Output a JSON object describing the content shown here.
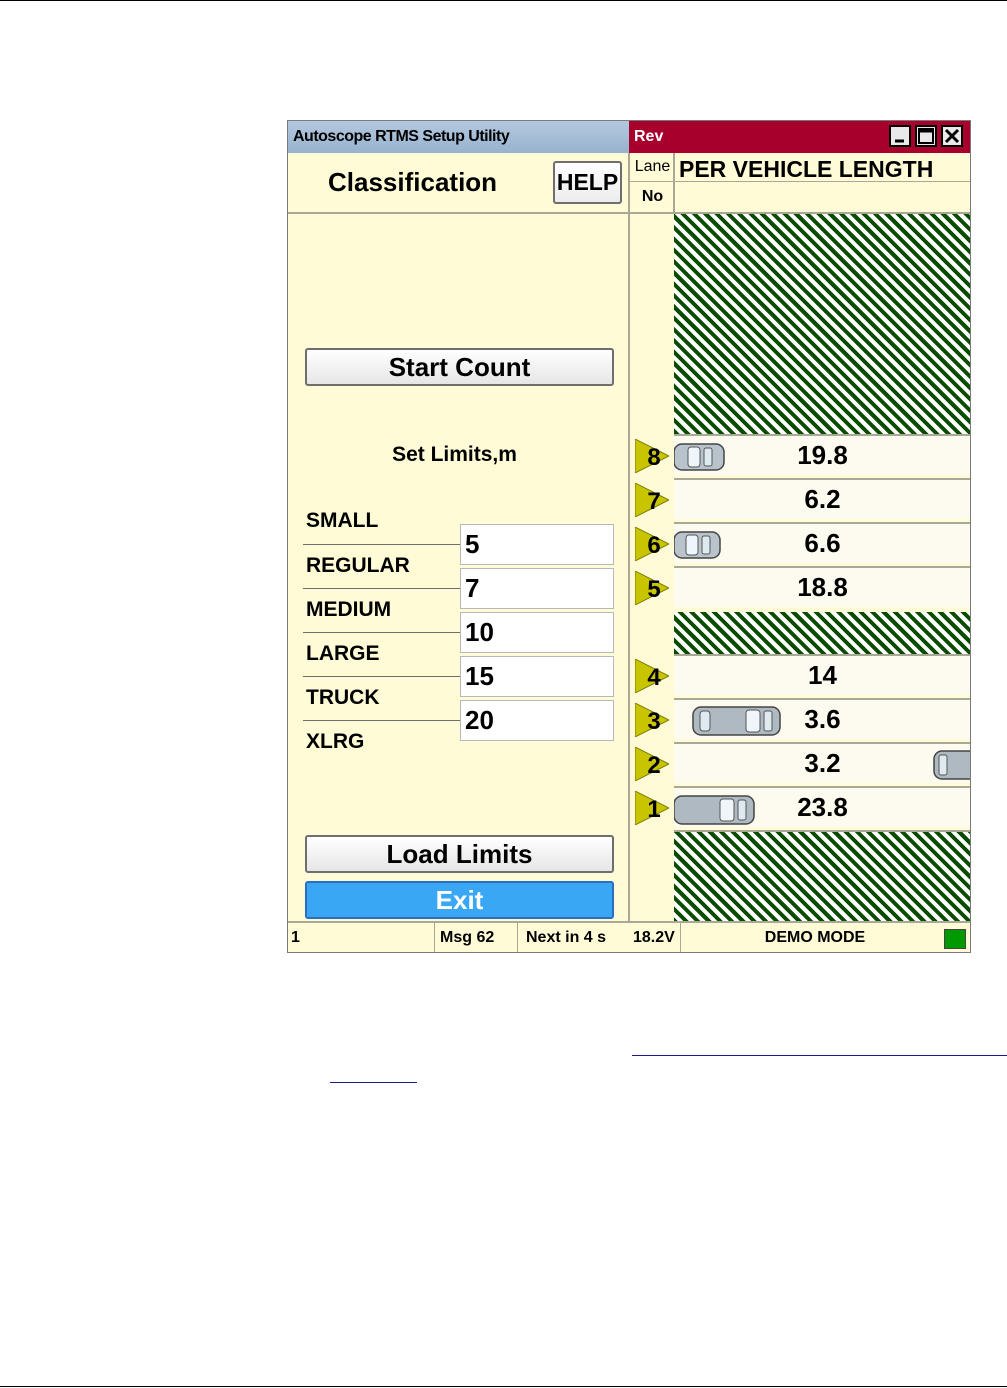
{
  "window": {
    "title": "Autoscope RTMS Setup Utility",
    "mode_label": "Rev",
    "icons": {
      "minimize": "minimize-icon",
      "maximize": "maximize-icon",
      "close": "close-icon"
    }
  },
  "header": {
    "section_title": "Classification",
    "help_label": "HELP",
    "lane_label": "Lane",
    "no_label": "No",
    "chart_title": "PER VEHICLE LENGTH"
  },
  "controls": {
    "start_count_label": "Start Count",
    "set_limits_label": "Set Limits,m",
    "load_limits_label": "Load Limits",
    "exit_label": "Exit"
  },
  "classes": [
    "SMALL",
    "REGULAR",
    "MEDIUM",
    "LARGE",
    "TRUCK",
    "XLRG"
  ],
  "limits": [
    "5",
    "7",
    "10",
    "15",
    "20"
  ],
  "lanes": [
    {
      "no": "8",
      "value": "19.8",
      "vehicle": "car-small"
    },
    {
      "no": "7",
      "value": "6.2",
      "vehicle": ""
    },
    {
      "no": "6",
      "value": "6.6",
      "vehicle": "car-small"
    },
    {
      "no": "5",
      "value": "18.8",
      "vehicle": ""
    },
    {
      "no": "4",
      "value": "14",
      "vehicle": ""
    },
    {
      "no": "3",
      "value": "3.6",
      "vehicle": "car-long"
    },
    {
      "no": "2",
      "value": "3.2",
      "vehicle": "car-edge"
    },
    {
      "no": "1",
      "value": "23.8",
      "vehicle": "car-medium"
    }
  ],
  "status": {
    "cell1": "1",
    "msg": "Msg 62",
    "next": "Next in 4 s",
    "voltage": "18.2V",
    "mode": "DEMO MODE",
    "indicator_color": "#009a00"
  },
  "colors": {
    "title_red": "#a8002c",
    "hatch_green": "#0a4d00",
    "exit_blue": "#3aa7f5",
    "panel_bg": "#fffbd6"
  }
}
